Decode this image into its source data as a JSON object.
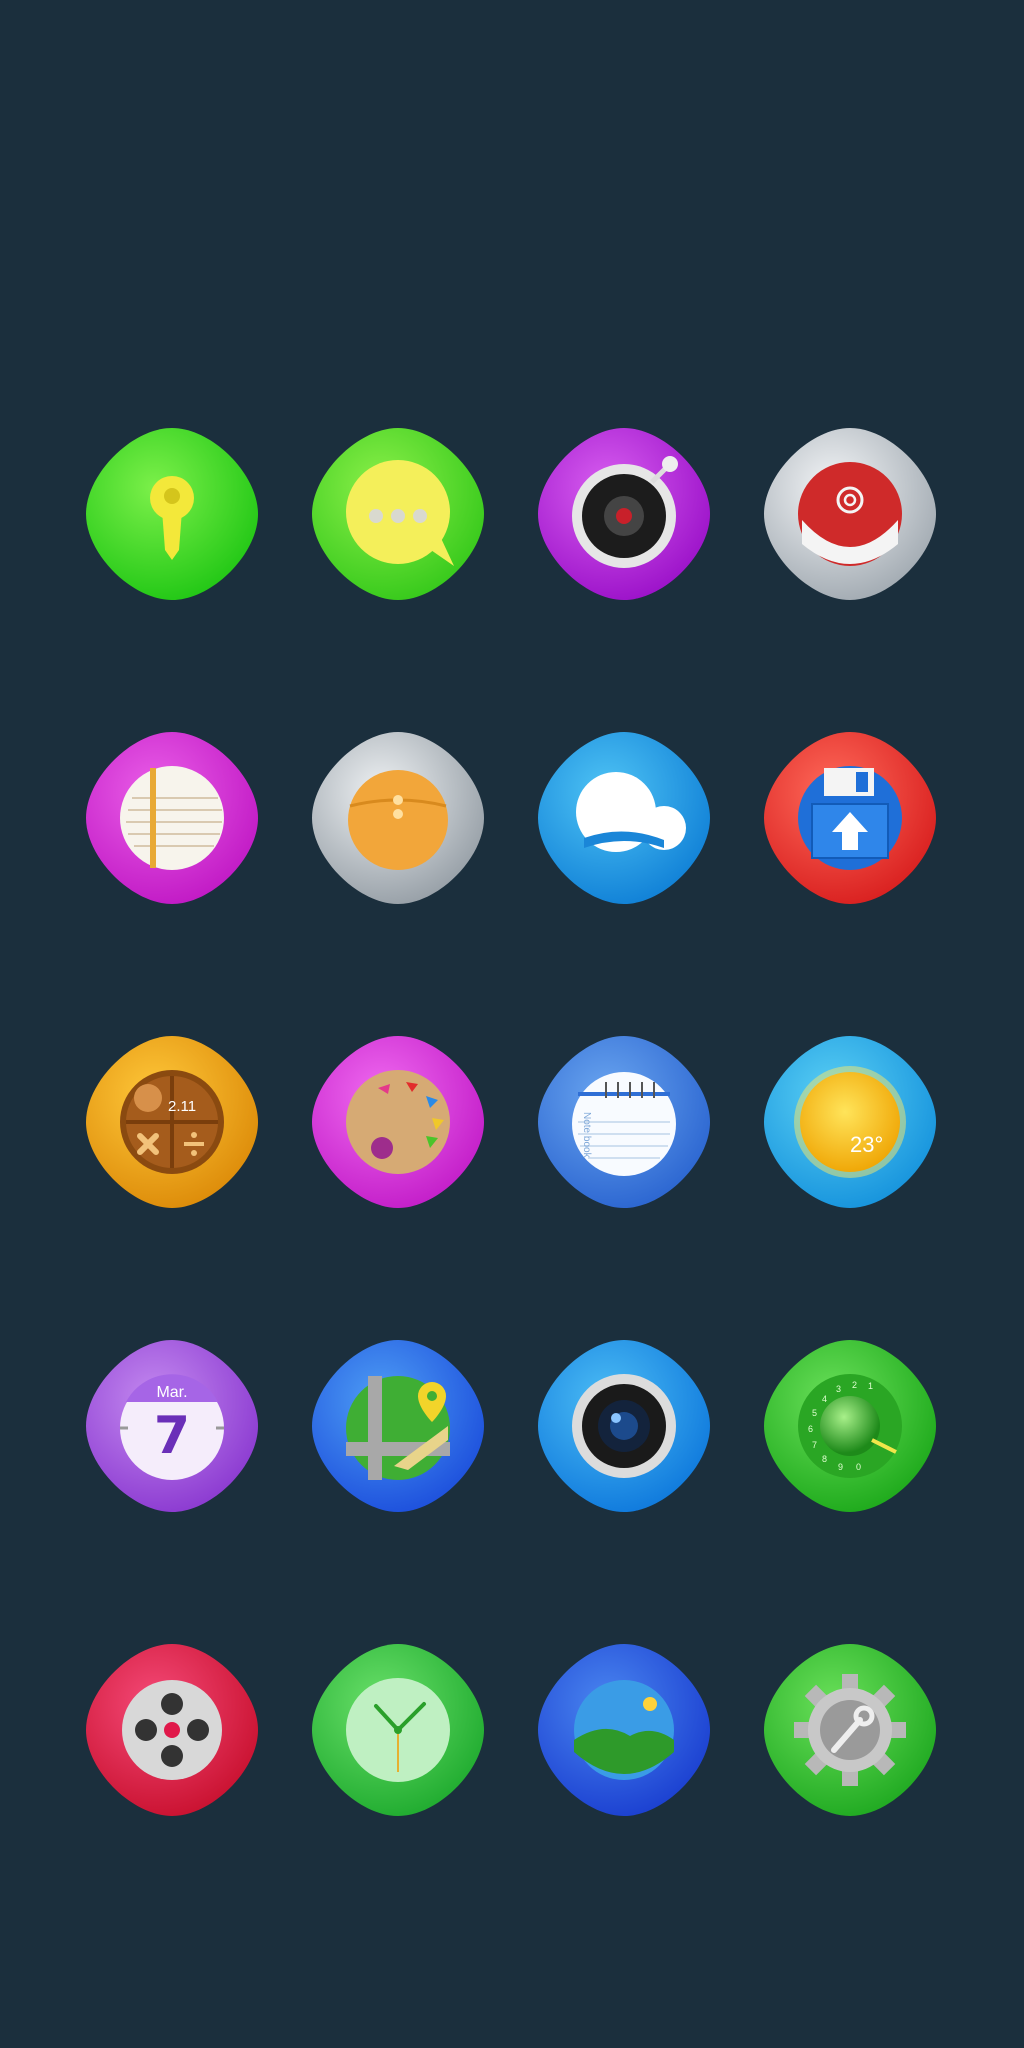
{
  "apps": [
    {
      "id": "lock",
      "color": "#2fd41a",
      "icon": "keyhole-icon"
    },
    {
      "id": "messages",
      "color": "#4fd61c",
      "icon": "chat-bubble-icon"
    },
    {
      "id": "music",
      "color": "#b51ed6",
      "icon": "speaker-icon"
    },
    {
      "id": "email",
      "color": "#c9cfd4",
      "icon": "mail-icon"
    },
    {
      "id": "notes",
      "color": "#d12ad0",
      "icon": "notepad-icon"
    },
    {
      "id": "files",
      "color": "#c3c9ce",
      "icon": "envelope-folder-icon"
    },
    {
      "id": "cloud",
      "color": "#1c9ae6",
      "icon": "cloud-icon"
    },
    {
      "id": "save",
      "color": "#ec2f2f",
      "icon": "floppy-disk-icon"
    },
    {
      "id": "calculator",
      "color": "#e5970a",
      "icon": "calculator-icon"
    },
    {
      "id": "paint",
      "color": "#d12dd6",
      "icon": "palette-icon"
    },
    {
      "id": "notebook",
      "color": "#3b7fdf",
      "icon": "notebook-icon"
    },
    {
      "id": "weather",
      "color": "#1aa8e0",
      "icon": "sun-icon"
    },
    {
      "id": "calendar",
      "color": "#9b4ad8",
      "icon": "calendar-icon"
    },
    {
      "id": "maps",
      "color": "#2a66e6",
      "icon": "map-pin-icon"
    },
    {
      "id": "camera",
      "color": "#1493e6",
      "icon": "camera-lens-icon"
    },
    {
      "id": "phone",
      "color": "#2fc41a",
      "icon": "rotary-dial-icon"
    },
    {
      "id": "video",
      "color": "#e0184a",
      "icon": "film-reel-icon"
    },
    {
      "id": "clock",
      "color": "#2ac43a",
      "icon": "clock-icon"
    },
    {
      "id": "gallery",
      "color": "#2256d8",
      "icon": "landscape-icon"
    },
    {
      "id": "settings",
      "color": "#2cc42a",
      "icon": "gear-icon"
    }
  ],
  "calculator": {
    "display": "2.11"
  },
  "notebook": {
    "brand": "Note book"
  },
  "weather": {
    "temperature": "23°"
  },
  "calendar": {
    "month": "Mar.",
    "day": "7"
  },
  "phone": {
    "digits": [
      "1",
      "2",
      "3",
      "4",
      "5",
      "6",
      "7",
      "8",
      "9",
      "0"
    ]
  }
}
